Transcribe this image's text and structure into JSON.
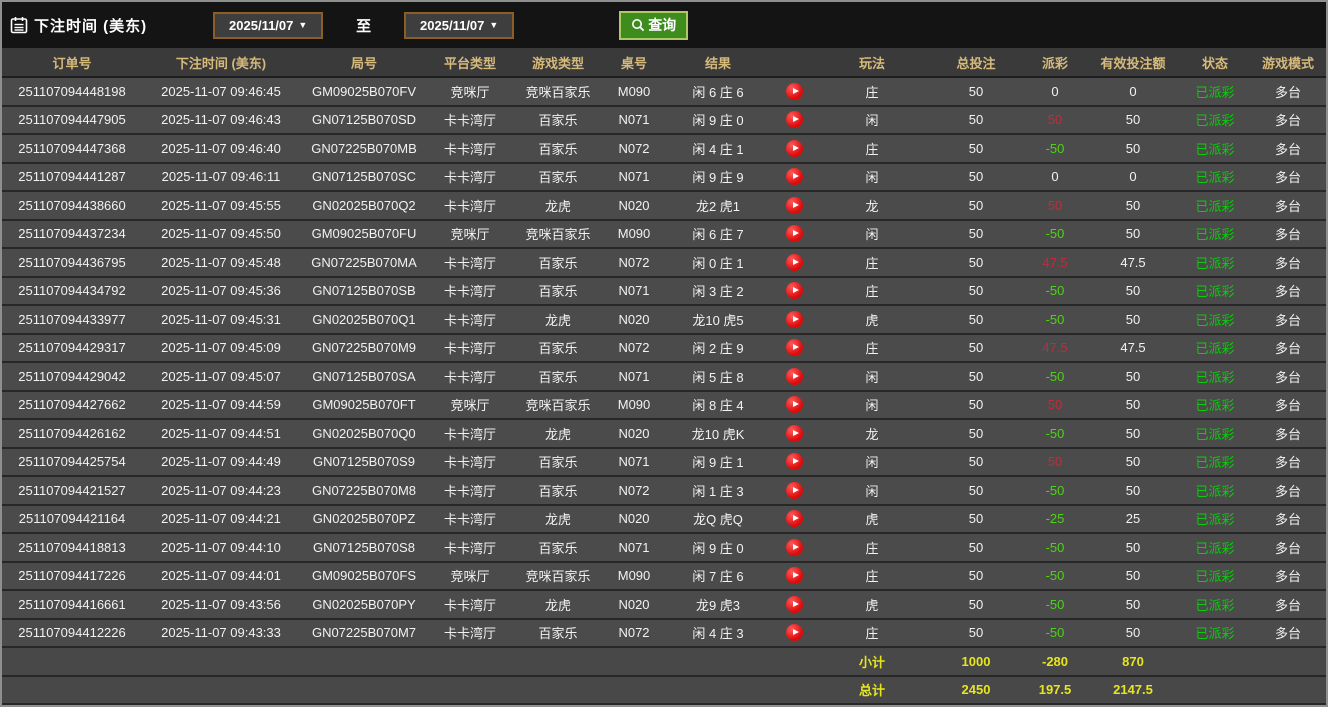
{
  "toolbar": {
    "title": "下注时间 (美东)",
    "date_from": "2025/11/07",
    "to_label": "至",
    "date_to": "2025/11/07",
    "query_label": "查询",
    "caret": "▼"
  },
  "colors": {
    "accent_gold_header": "#d6ba7b",
    "payout_positive_red": "#c42a3a",
    "payout_negative_green": "#4cd414",
    "status_green": "#0acc0a",
    "totals_yellow": "#e6e61e",
    "query_button_green": "#3e8c1e",
    "date_border_brown": "#8b5e26"
  },
  "table": {
    "headers": [
      "订单号",
      "下注时间 (美东)",
      "局号",
      "平台类型",
      "游戏类型",
      "桌号",
      "结果",
      "",
      "玩法",
      "总投注",
      "派彩",
      "有效投注额",
      "状态",
      "游戏模式"
    ],
    "rows": [
      {
        "order": "251107094448198",
        "time": "2025-11-07 09:46:45",
        "game_no": "GM09025B070FV",
        "platform": "竞咪厅",
        "game_type": "竞咪百家乐",
        "table_no": "M090",
        "result": "闲 6 庄 6",
        "method": "庄",
        "total_bet": "50",
        "payout": "0",
        "payout_color": "white",
        "valid_bet": "0",
        "status": "已派彩",
        "mode": "多台"
      },
      {
        "order": "251107094447905",
        "time": "2025-11-07 09:46:43",
        "game_no": "GN07125B070SD",
        "platform": "卡卡湾厅",
        "game_type": "百家乐",
        "table_no": "N071",
        "result": "闲 9 庄 0",
        "method": "闲",
        "total_bet": "50",
        "payout": "50",
        "payout_color": "red",
        "valid_bet": "50",
        "status": "已派彩",
        "mode": "多台"
      },
      {
        "order": "251107094447368",
        "time": "2025-11-07 09:46:40",
        "game_no": "GN07225B070MB",
        "platform": "卡卡湾厅",
        "game_type": "百家乐",
        "table_no": "N072",
        "result": "闲 4 庄 1",
        "method": "庄",
        "total_bet": "50",
        "payout": "-50",
        "payout_color": "green",
        "valid_bet": "50",
        "status": "已派彩",
        "mode": "多台"
      },
      {
        "order": "251107094441287",
        "time": "2025-11-07 09:46:11",
        "game_no": "GN07125B070SC",
        "platform": "卡卡湾厅",
        "game_type": "百家乐",
        "table_no": "N071",
        "result": "闲 9 庄 9",
        "method": "闲",
        "total_bet": "50",
        "payout": "0",
        "payout_color": "white",
        "valid_bet": "0",
        "status": "已派彩",
        "mode": "多台"
      },
      {
        "order": "251107094438660",
        "time": "2025-11-07 09:45:55",
        "game_no": "GN02025B070Q2",
        "platform": "卡卡湾厅",
        "game_type": "龙虎",
        "table_no": "N020",
        "result": "龙2 虎1",
        "method": "龙",
        "total_bet": "50",
        "payout": "50",
        "payout_color": "red",
        "valid_bet": "50",
        "status": "已派彩",
        "mode": "多台"
      },
      {
        "order": "251107094437234",
        "time": "2025-11-07 09:45:50",
        "game_no": "GM09025B070FU",
        "platform": "竞咪厅",
        "game_type": "竞咪百家乐",
        "table_no": "M090",
        "result": "闲 6 庄 7",
        "method": "闲",
        "total_bet": "50",
        "payout": "-50",
        "payout_color": "green",
        "valid_bet": "50",
        "status": "已派彩",
        "mode": "多台"
      },
      {
        "order": "251107094436795",
        "time": "2025-11-07 09:45:48",
        "game_no": "GN07225B070MA",
        "platform": "卡卡湾厅",
        "game_type": "百家乐",
        "table_no": "N072",
        "result": "闲 0 庄 1",
        "method": "庄",
        "total_bet": "50",
        "payout": "47.5",
        "payout_color": "red",
        "valid_bet": "47.5",
        "status": "已派彩",
        "mode": "多台"
      },
      {
        "order": "251107094434792",
        "time": "2025-11-07 09:45:36",
        "game_no": "GN07125B070SB",
        "platform": "卡卡湾厅",
        "game_type": "百家乐",
        "table_no": "N071",
        "result": "闲 3 庄 2",
        "method": "庄",
        "total_bet": "50",
        "payout": "-50",
        "payout_color": "green",
        "valid_bet": "50",
        "status": "已派彩",
        "mode": "多台"
      },
      {
        "order": "251107094433977",
        "time": "2025-11-07 09:45:31",
        "game_no": "GN02025B070Q1",
        "platform": "卡卡湾厅",
        "game_type": "龙虎",
        "table_no": "N020",
        "result": "龙10 虎5",
        "method": "虎",
        "total_bet": "50",
        "payout": "-50",
        "payout_color": "green",
        "valid_bet": "50",
        "status": "已派彩",
        "mode": "多台"
      },
      {
        "order": "251107094429317",
        "time": "2025-11-07 09:45:09",
        "game_no": "GN07225B070M9",
        "platform": "卡卡湾厅",
        "game_type": "百家乐",
        "table_no": "N072",
        "result": "闲 2 庄 9",
        "method": "庄",
        "total_bet": "50",
        "payout": "47.5",
        "payout_color": "red",
        "valid_bet": "47.5",
        "status": "已派彩",
        "mode": "多台"
      },
      {
        "order": "251107094429042",
        "time": "2025-11-07 09:45:07",
        "game_no": "GN07125B070SA",
        "platform": "卡卡湾厅",
        "game_type": "百家乐",
        "table_no": "N071",
        "result": "闲 5 庄 8",
        "method": "闲",
        "total_bet": "50",
        "payout": "-50",
        "payout_color": "green",
        "valid_bet": "50",
        "status": "已派彩",
        "mode": "多台"
      },
      {
        "order": "251107094427662",
        "time": "2025-11-07 09:44:59",
        "game_no": "GM09025B070FT",
        "platform": "竞咪厅",
        "game_type": "竞咪百家乐",
        "table_no": "M090",
        "result": "闲 8 庄 4",
        "method": "闲",
        "total_bet": "50",
        "payout": "50",
        "payout_color": "red",
        "valid_bet": "50",
        "status": "已派彩",
        "mode": "多台"
      },
      {
        "order": "251107094426162",
        "time": "2025-11-07 09:44:51",
        "game_no": "GN02025B070Q0",
        "platform": "卡卡湾厅",
        "game_type": "龙虎",
        "table_no": "N020",
        "result": "龙10 虎K",
        "method": "龙",
        "total_bet": "50",
        "payout": "-50",
        "payout_color": "green",
        "valid_bet": "50",
        "status": "已派彩",
        "mode": "多台"
      },
      {
        "order": "251107094425754",
        "time": "2025-11-07 09:44:49",
        "game_no": "GN07125B070S9",
        "platform": "卡卡湾厅",
        "game_type": "百家乐",
        "table_no": "N071",
        "result": "闲 9 庄 1",
        "method": "闲",
        "total_bet": "50",
        "payout": "50",
        "payout_color": "red",
        "valid_bet": "50",
        "status": "已派彩",
        "mode": "多台"
      },
      {
        "order": "251107094421527",
        "time": "2025-11-07 09:44:23",
        "game_no": "GN07225B070M8",
        "platform": "卡卡湾厅",
        "game_type": "百家乐",
        "table_no": "N072",
        "result": "闲 1 庄 3",
        "method": "闲",
        "total_bet": "50",
        "payout": "-50",
        "payout_color": "green",
        "valid_bet": "50",
        "status": "已派彩",
        "mode": "多台"
      },
      {
        "order": "251107094421164",
        "time": "2025-11-07 09:44:21",
        "game_no": "GN02025B070PZ",
        "platform": "卡卡湾厅",
        "game_type": "龙虎",
        "table_no": "N020",
        "result": "龙Q 虎Q",
        "method": "虎",
        "total_bet": "50",
        "payout": "-25",
        "payout_color": "green",
        "valid_bet": "25",
        "status": "已派彩",
        "mode": "多台"
      },
      {
        "order": "251107094418813",
        "time": "2025-11-07 09:44:10",
        "game_no": "GN07125B070S8",
        "platform": "卡卡湾厅",
        "game_type": "百家乐",
        "table_no": "N071",
        "result": "闲 9 庄 0",
        "method": "庄",
        "total_bet": "50",
        "payout": "-50",
        "payout_color": "green",
        "valid_bet": "50",
        "status": "已派彩",
        "mode": "多台"
      },
      {
        "order": "251107094417226",
        "time": "2025-11-07 09:44:01",
        "game_no": "GM09025B070FS",
        "platform": "竞咪厅",
        "game_type": "竞咪百家乐",
        "table_no": "M090",
        "result": "闲 7 庄 6",
        "method": "庄",
        "total_bet": "50",
        "payout": "-50",
        "payout_color": "green",
        "valid_bet": "50",
        "status": "已派彩",
        "mode": "多台"
      },
      {
        "order": "251107094416661",
        "time": "2025-11-07 09:43:56",
        "game_no": "GN02025B070PY",
        "platform": "卡卡湾厅",
        "game_type": "龙虎",
        "table_no": "N020",
        "result": "龙9 虎3",
        "method": "虎",
        "total_bet": "50",
        "payout": "-50",
        "payout_color": "green",
        "valid_bet": "50",
        "status": "已派彩",
        "mode": "多台"
      },
      {
        "order": "251107094412226",
        "time": "2025-11-07 09:43:33",
        "game_no": "GN07225B070M7",
        "platform": "卡卡湾厅",
        "game_type": "百家乐",
        "table_no": "N072",
        "result": "闲 4 庄 3",
        "method": "庄",
        "total_bet": "50",
        "payout": "-50",
        "payout_color": "green",
        "valid_bet": "50",
        "status": "已派彩",
        "mode": "多台"
      }
    ],
    "subtotal": {
      "label": "小计",
      "total_bet": "1000",
      "payout": "-280",
      "valid_bet": "870"
    },
    "total": {
      "label": "总计",
      "total_bet": "2450",
      "payout": "197.5",
      "valid_bet": "2147.5"
    }
  }
}
